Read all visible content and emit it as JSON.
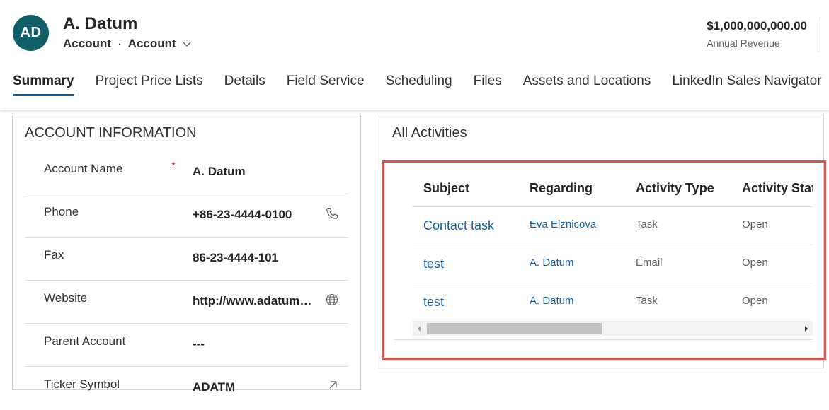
{
  "record": {
    "initials": "AD",
    "name": "A. Datum",
    "entity": "Account",
    "separator": "·",
    "form": "Account"
  },
  "kpi": {
    "value": "$1,000,000,000.00",
    "label": "Annual Revenue"
  },
  "tabs": [
    {
      "label": "Summary",
      "active": true
    },
    {
      "label": "Project Price Lists"
    },
    {
      "label": "Details"
    },
    {
      "label": "Field Service"
    },
    {
      "label": "Scheduling"
    },
    {
      "label": "Files"
    },
    {
      "label": "Assets and Locations"
    },
    {
      "label": "LinkedIn Sales Navigator"
    }
  ],
  "account_info": {
    "title": "ACCOUNT INFORMATION",
    "fields": [
      {
        "label": "Account Name",
        "value": "A. Datum",
        "required_mark": "*"
      },
      {
        "label": "Phone",
        "value": "+86-23-4444-0100",
        "icon": "phone-icon"
      },
      {
        "label": "Fax",
        "value": "86-23-4444-101"
      },
      {
        "label": "Website",
        "value": "http://www.adatum.com",
        "icon": "globe-icon"
      },
      {
        "label": "Parent Account",
        "value": "---"
      },
      {
        "label": "Ticker Symbol",
        "value": "ADATM",
        "icon": "external-link-icon"
      }
    ]
  },
  "activities": {
    "title": "All Activities",
    "columns": [
      "Subject",
      "Regarding",
      "Activity Type",
      "Activity Status"
    ],
    "rows": [
      {
        "subject": "Contact task",
        "regarding": "Eva Elznicova",
        "type": "Task",
        "status": "Open"
      },
      {
        "subject": "test",
        "regarding": "A. Datum",
        "type": "Email",
        "status": "Open"
      },
      {
        "subject": "test",
        "regarding": "A. Datum",
        "type": "Task",
        "status": "Open"
      }
    ]
  },
  "colors": {
    "avatar": "#0f5e68",
    "accent": "#115ea3",
    "highlight_border": "#d9534f",
    "required": "#c50f1f"
  }
}
